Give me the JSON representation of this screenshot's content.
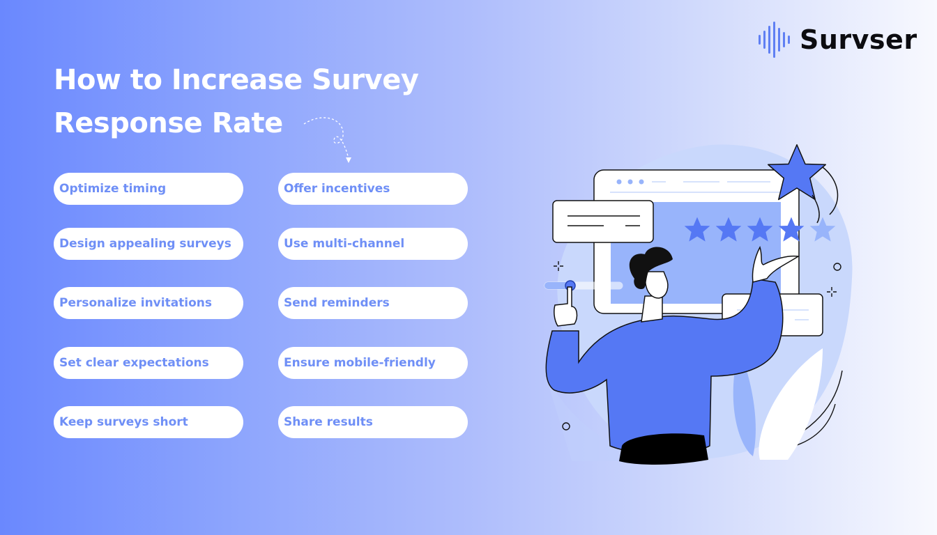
{
  "brand": {
    "logo_icon": "sound-wave-icon",
    "name": "Survser"
  },
  "title": {
    "line1": "How to Increase Survey",
    "line2": "Response Rate"
  },
  "tips_left": [
    {
      "label": "Optimize timing"
    },
    {
      "label": "Design appealing surveys"
    },
    {
      "label": "Personalize invitations"
    },
    {
      "label": "Set clear expectations"
    },
    {
      "label": "Keep surveys short"
    }
  ],
  "tips_right": [
    {
      "label": "Offer incentives"
    },
    {
      "label": "Use multi-channel"
    },
    {
      "label": "Send reminders"
    },
    {
      "label": "Ensure mobile-friendly"
    },
    {
      "label": "Share results"
    }
  ],
  "illustration": {
    "description": "person-rating-stars",
    "rating_stars_filled": 4,
    "rating_stars_total": 5
  },
  "colors": {
    "accent": "#5578f4",
    "pill_text": "#6f8ff6",
    "title_text": "#ffffff",
    "brand_text": "#0c0c10"
  }
}
